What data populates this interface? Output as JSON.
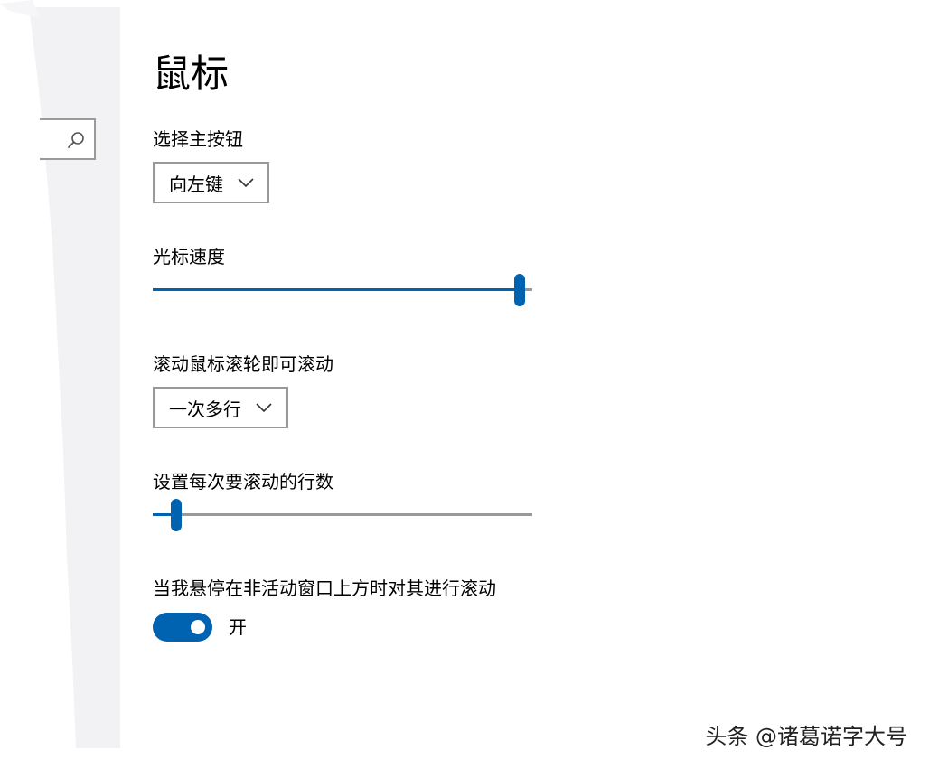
{
  "page": {
    "title": "鼠标"
  },
  "search": {
    "icon": "search-icon"
  },
  "primary_button": {
    "label": "选择主按钮",
    "selected": "向左键"
  },
  "cursor_speed": {
    "label": "光标速度",
    "value_fraction": 1.0
  },
  "scroll_mode": {
    "label": "滚动鼠标滚轮即可滚动",
    "selected": "一次多行"
  },
  "scroll_lines": {
    "label": "设置每次要滚动的行数",
    "value_fraction": 0.03
  },
  "inactive_scroll": {
    "label": "当我悬停在非活动窗口上方时对其进行滚动",
    "state": "开",
    "enabled": true
  },
  "watermark": {
    "text": "头条 @诸葛诺字大号"
  },
  "colors": {
    "accent": "#0063b1",
    "border": "#999999",
    "sidebar": "#f2f2f4"
  }
}
